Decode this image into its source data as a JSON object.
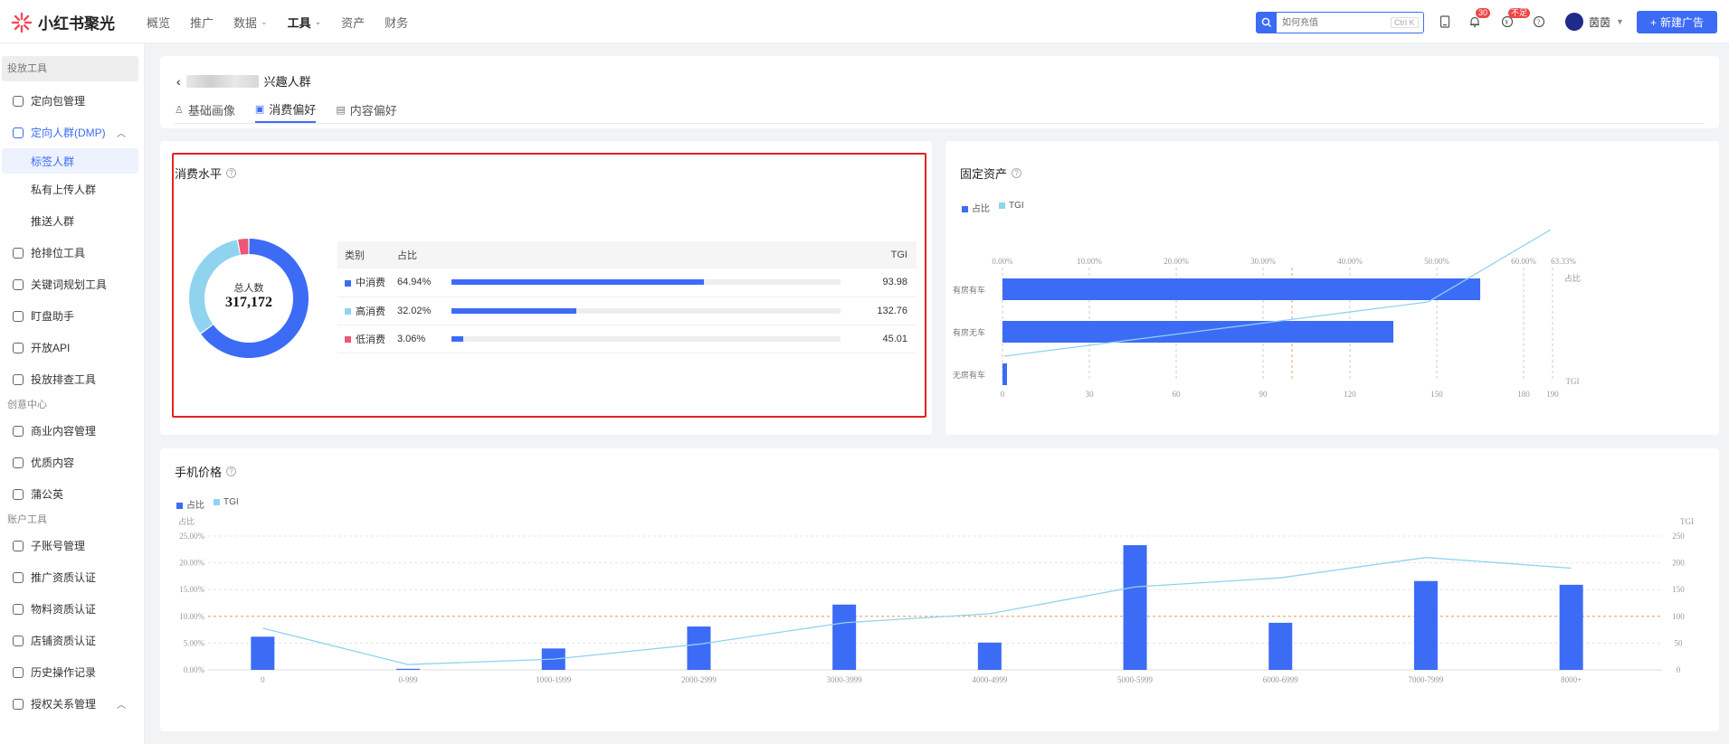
{
  "app": {
    "name": "小红书聚光"
  },
  "topnav": [
    {
      "label": "概览",
      "active": false,
      "dropdown": false
    },
    {
      "label": "推广",
      "active": false,
      "dropdown": false
    },
    {
      "label": "数据",
      "active": false,
      "dropdown": true
    },
    {
      "label": "工具",
      "active": true,
      "dropdown": true
    },
    {
      "label": "资产",
      "active": false,
      "dropdown": false
    },
    {
      "label": "财务",
      "active": false,
      "dropdown": false
    }
  ],
  "search": {
    "placeholder": "如何充值",
    "shortcut": "Ctrl K"
  },
  "notifications": {
    "count": "30"
  },
  "alert_badge": "不足",
  "user": {
    "name": "茵茵"
  },
  "new_ad_label": "新建广告",
  "sidebar": {
    "section_launch": "投放工具",
    "items_launch": [
      {
        "label": "定向包管理"
      },
      {
        "label": "定向人群(DMP)",
        "open": true
      },
      {
        "label": "标签人群",
        "sub": true,
        "selected": true
      },
      {
        "label": "私有上传人群",
        "sub": true
      },
      {
        "label": "推送人群",
        "sub": true
      },
      {
        "label": "抢排位工具"
      },
      {
        "label": "关键词规划工具"
      },
      {
        "label": "盯盘助手"
      },
      {
        "label": "开放API"
      },
      {
        "label": "投放排查工具"
      }
    ],
    "section_create": "创意中心",
    "items_create": [
      {
        "label": "商业内容管理"
      },
      {
        "label": "优质内容"
      },
      {
        "label": "蒲公英"
      }
    ],
    "section_account": "账户工具",
    "items_account": [
      {
        "label": "子账号管理"
      },
      {
        "label": "推广资质认证"
      },
      {
        "label": "物料资质认证"
      },
      {
        "label": "店铺资质认证"
      },
      {
        "label": "历史操作记录"
      },
      {
        "label": "授权关系管理",
        "open": true
      }
    ]
  },
  "page": {
    "title_suffix": "兴趣人群",
    "tabs": [
      {
        "label": "基础画像",
        "active": false
      },
      {
        "label": "消费偏好",
        "active": true
      },
      {
        "label": "内容偏好",
        "active": false
      }
    ]
  },
  "consumption": {
    "title": "消费水平",
    "total_label": "总人数",
    "total_value": "317,172",
    "columns": [
      "类别",
      "占比",
      "TGI"
    ],
    "rows": [
      {
        "name": "中消费",
        "pct": "64.94%",
        "pct_value": 64.94,
        "tgi": "93.98",
        "color": "#3c6cf5"
      },
      {
        "name": "高消费",
        "pct": "32.02%",
        "pct_value": 32.02,
        "tgi": "132.76",
        "color": "#8fd3ef"
      },
      {
        "name": "低消费",
        "pct": "3.06%",
        "pct_value": 3.06,
        "tgi": "45.01",
        "color": "#ee5577"
      }
    ]
  },
  "legend": {
    "share": "占比",
    "tgi": "TGI"
  },
  "fixed_assets": {
    "title": "固定资产"
  },
  "phone_price": {
    "title": "手机价格",
    "y_left_label": "占比",
    "y_right_label": "TGI"
  },
  "chart_data": [
    {
      "type": "bar",
      "orientation": "horizontal",
      "title": "固定资产",
      "categories": [
        "有房有车",
        "有房无车",
        "无房有车"
      ],
      "series": [
        {
          "name": "占比",
          "values": [
            0.55,
            0.45,
            0.005
          ],
          "color": "#3c6cf5"
        },
        {
          "name": "TGI",
          "values": [
            190,
            147,
            0
          ],
          "color": "#8fd3ef"
        }
      ],
      "top_ticks": [
        "0.00%",
        "10.00%",
        "20.00%",
        "30.00%",
        "40.00%",
        "50.00%",
        "60.00%",
        "63.33%"
      ],
      "bottom_ticks": [
        "0",
        "30",
        "60",
        "90",
        "120",
        "150",
        "180",
        "190"
      ],
      "bottom_axis_label": "TGI",
      "top_axis_label": "占比",
      "xlim_pct": [
        0,
        0.6333
      ],
      "xlim_tgi": [
        0,
        190
      ],
      "reference_line_tgi": 100
    },
    {
      "type": "bar",
      "title": "手机价格",
      "categories": [
        "0",
        "0-999",
        "1000-1999",
        "2000-2999",
        "3000-3999",
        "4000-4999",
        "5000-5999",
        "6000-6999",
        "7000-7999",
        "8000+"
      ],
      "series": [
        {
          "name": "占比",
          "values": [
            6.2,
            0.2,
            4.0,
            8.1,
            12.2,
            5.1,
            23.3,
            8.8,
            16.6,
            15.9
          ],
          "color": "#3c6cf5"
        },
        {
          "name": "TGI",
          "values": [
            78,
            10,
            20,
            48,
            88,
            105,
            155,
            172,
            210,
            190
          ],
          "color": "#8fd3ef",
          "type": "line"
        }
      ],
      "y_ticks_left": [
        "0.00%",
        "5.00%",
        "10.00%",
        "15.00%",
        "20.00%",
        "25.00%"
      ],
      "y_ticks_right": [
        "0",
        "50",
        "100",
        "150",
        "200",
        "250"
      ],
      "ylim_left": [
        0,
        25
      ],
      "ylim_right": [
        0,
        250
      ],
      "reference_line_tgi": 100
    }
  ]
}
